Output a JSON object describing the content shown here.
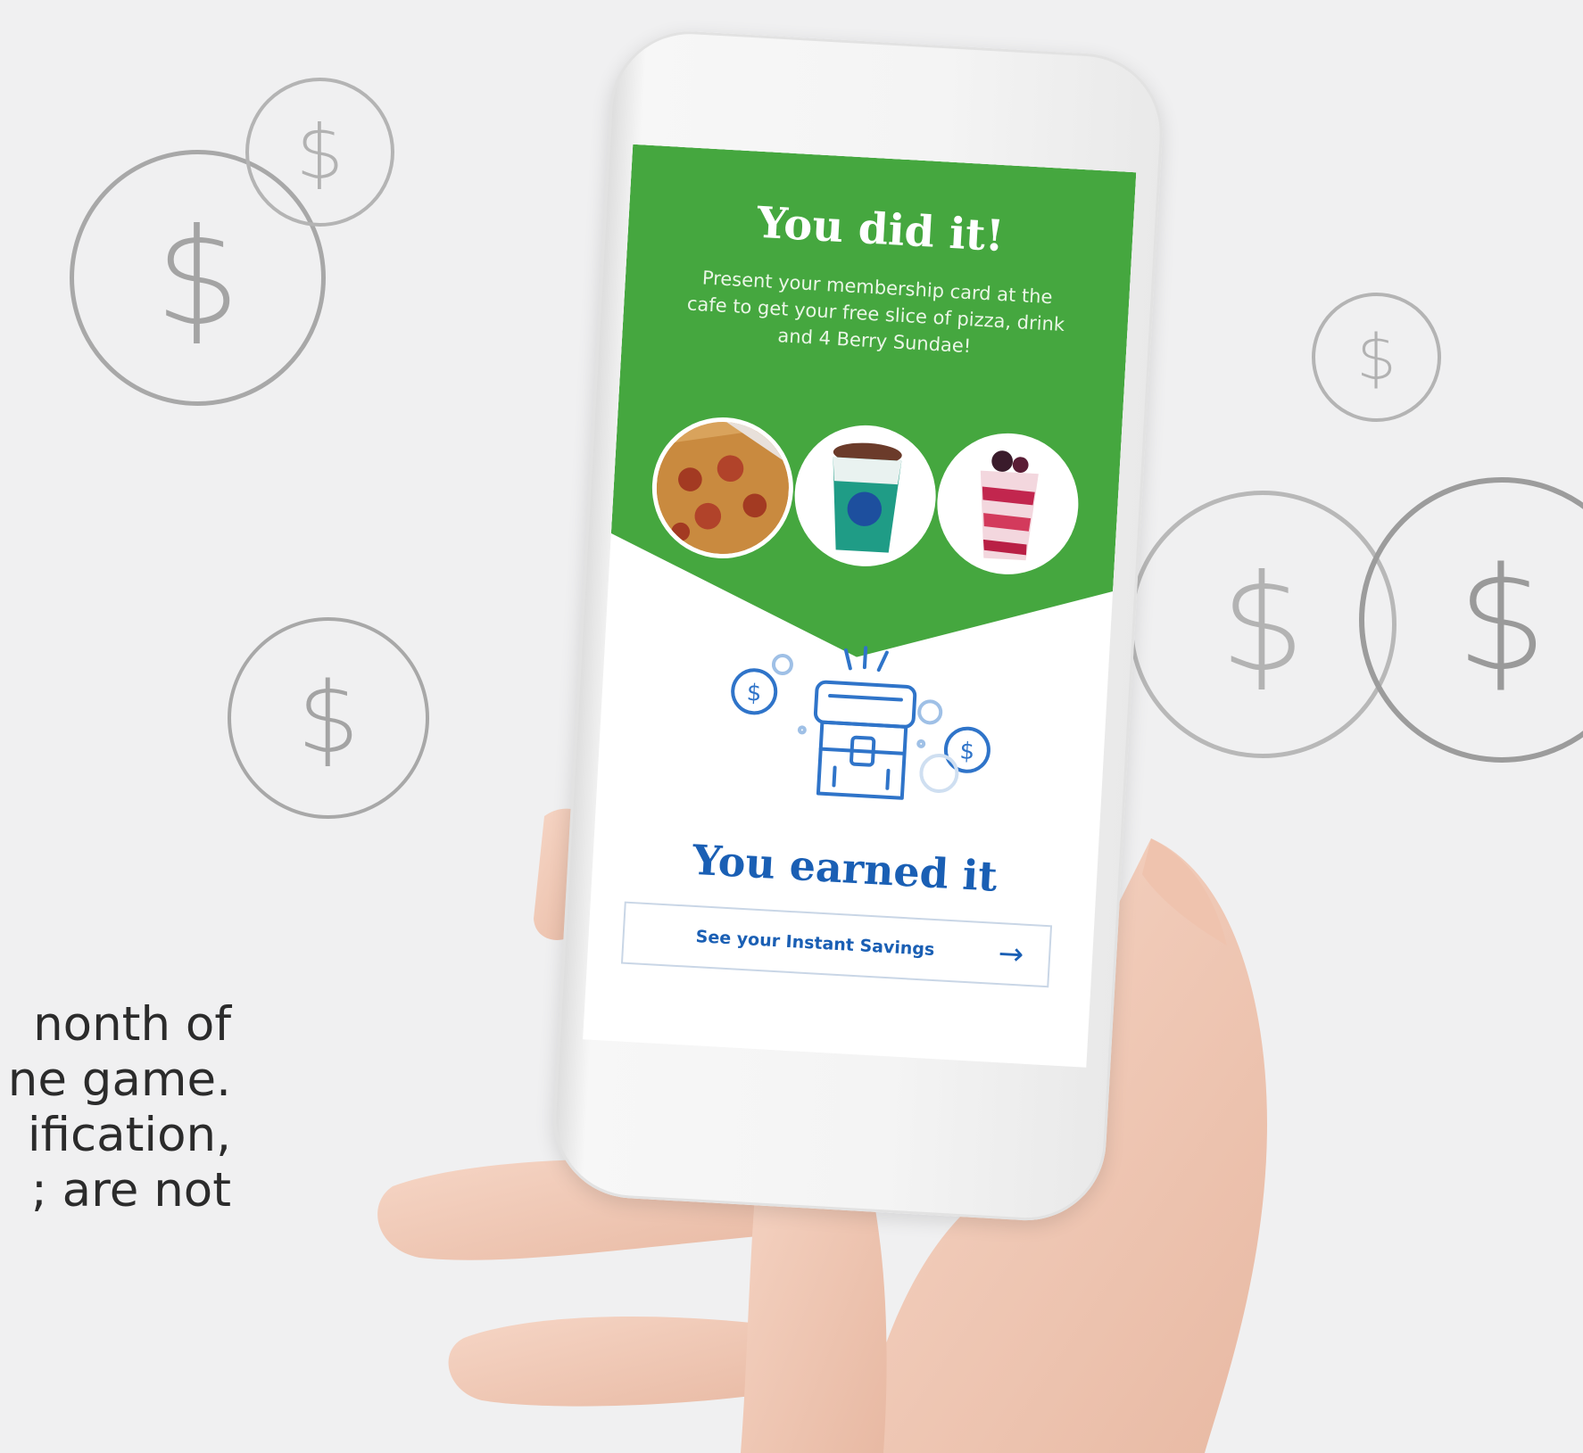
{
  "background": {
    "coin_symbol": "$",
    "coin_color": "#a8a8a8",
    "page_color": "#f0f0f1"
  },
  "intro_text": {
    "lines": [
      "nonth of",
      "ne game.",
      "ification,",
      "; are not"
    ]
  },
  "screen": {
    "title": "You did it!",
    "message": "Present your membership card at the cafe to get your free slice of pizza, drink and 4 Berry Sundae!",
    "header_color": "#45a73f",
    "food_items": [
      {
        "name": "pizza-slice-image"
      },
      {
        "name": "drink-cup-image"
      },
      {
        "name": "berry-sundae-image"
      }
    ],
    "chest_icon": "treasure-chest-icon",
    "coin_icon_symbol": "$",
    "earned_title": "You earned it",
    "accent_color": "#1a5fb4",
    "cta": {
      "label": "See your Instant Savings",
      "arrow": "→"
    }
  }
}
